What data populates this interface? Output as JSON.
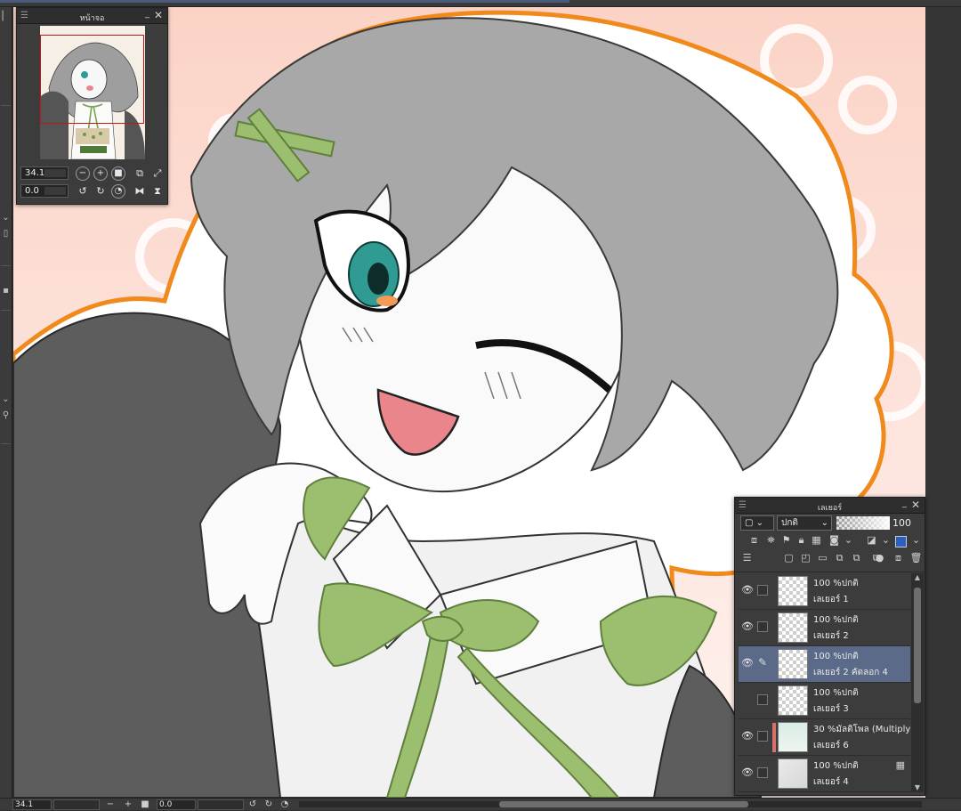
{
  "canvas": {
    "colors": {
      "background_pink": "#fbd9cf",
      "outline_orange": "#f08a1c",
      "hair_gray": "#a9a9a9",
      "jacket_gray": "#5a5a5a",
      "ribbon_green": "#9bbf6e",
      "eye_teal": "#2f9b93",
      "mouth_pink": "#e9858b"
    }
  },
  "navigator": {
    "title": "หน้าจอ",
    "zoom_value": "34.1",
    "rotation_value": "0.0",
    "icons": {
      "zoom_out": "zoom-out-icon",
      "zoom_in": "zoom-in-icon",
      "actual_size": "actual-size-icon",
      "fit": "fit-window-icon",
      "fill": "fill-window-icon",
      "rotate_left": "rotate-left-icon",
      "rotate_right": "rotate-right-icon",
      "reset_rotation": "reset-rotation-icon",
      "flip_h": "flip-horizontal-icon",
      "flip_v": "flip-vertical-icon"
    }
  },
  "layers_panel": {
    "title": "เลเยอร์",
    "blend_mode": "ปกติ",
    "opacity": "100",
    "opacity_fraction": 1.0,
    "layers": [
      {
        "opacity_mode": "100 %ปกติ",
        "name": "เลเยอร์ 1",
        "visible": true,
        "selected": false,
        "thumb": "checker",
        "color_bar": ""
      },
      {
        "opacity_mode": "100 %ปกติ",
        "name": "เลเยอร์ 2",
        "visible": true,
        "selected": false,
        "thumb": "checker",
        "color_bar": ""
      },
      {
        "opacity_mode": "100 %ปกติ",
        "name": "เลเยอร์ 2 คัดลอก 4",
        "visible": true,
        "selected": true,
        "thumb": "checker",
        "color_bar": ""
      },
      {
        "opacity_mode": "100 %ปกติ",
        "name": "เลเยอร์ 3",
        "visible": false,
        "selected": false,
        "thumb": "checker",
        "color_bar": ""
      },
      {
        "opacity_mode": "30 %มัลติโพล (Multiply)",
        "name": "เลเยอร์ 6",
        "visible": true,
        "selected": false,
        "thumb": "gradient",
        "color_bar": "#d9706a"
      },
      {
        "opacity_mode": "100 %ปกติ",
        "name": "เลเยอร์ 4",
        "visible": true,
        "selected": false,
        "thumb": "art",
        "color_bar": ""
      }
    ]
  },
  "status": {
    "zoom_value": "34.1",
    "rotation_value": "0.0"
  }
}
